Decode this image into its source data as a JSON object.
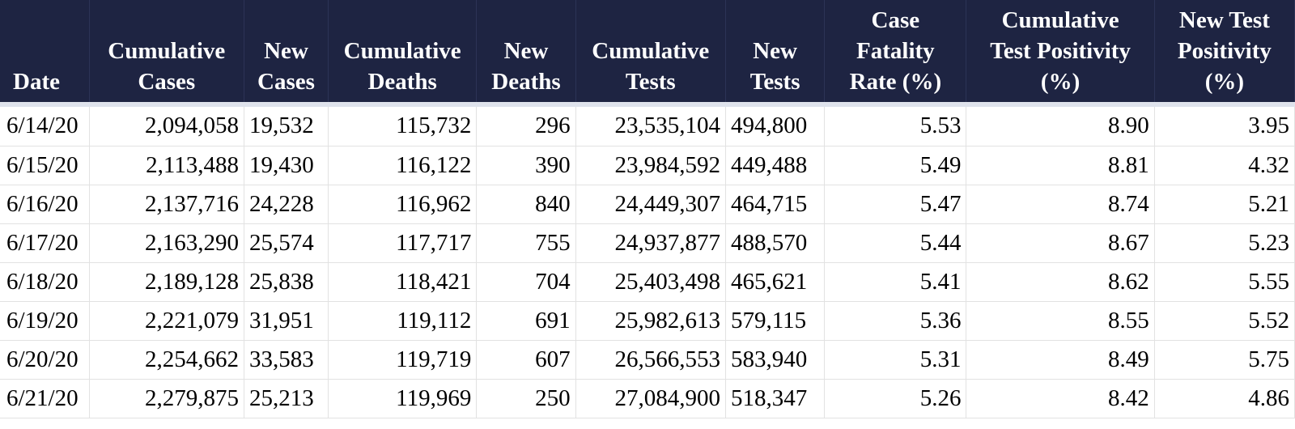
{
  "table": {
    "headers": [
      "Date",
      "Cumulative\nCases",
      "New\nCases",
      "Cumulative\nDeaths",
      "New\nDeaths",
      "Cumulative\nTests",
      "New\nTests",
      "Case\nFatality\nRate (%)",
      "Cumulative\nTest Positivity\n(%)",
      "New Test\nPositivity\n(%)"
    ],
    "rows": [
      [
        "6/14/20",
        "2,094,058",
        "19,532",
        "115,732",
        "296",
        "23,535,104",
        "494,800",
        "5.53",
        "8.90",
        "3.95"
      ],
      [
        "6/15/20",
        "2,113,488",
        "19,430",
        "116,122",
        "390",
        "23,984,592",
        "449,488",
        "5.49",
        "8.81",
        "4.32"
      ],
      [
        "6/16/20",
        "2,137,716",
        "24,228",
        "116,962",
        "840",
        "24,449,307",
        "464,715",
        "5.47",
        "8.74",
        "5.21"
      ],
      [
        "6/17/20",
        "2,163,290",
        "25,574",
        "117,717",
        "755",
        "24,937,877",
        "488,570",
        "5.44",
        "8.67",
        "5.23"
      ],
      [
        "6/18/20",
        "2,189,128",
        "25,838",
        "118,421",
        "704",
        "25,403,498",
        "465,621",
        "5.41",
        "8.62",
        "5.55"
      ],
      [
        "6/19/20",
        "2,221,079",
        "31,951",
        "119,112",
        "691",
        "25,982,613",
        "579,115",
        "5.36",
        "8.55",
        "5.52"
      ],
      [
        "6/20/20",
        "2,254,662",
        "33,583",
        "119,719",
        "607",
        "26,566,553",
        "583,940",
        "5.31",
        "8.49",
        "5.75"
      ],
      [
        "6/21/20",
        "2,279,875",
        "25,213",
        "119,969",
        "250",
        "27,084,900",
        "518,347",
        "5.26",
        "8.42",
        "4.86"
      ]
    ]
  },
  "colors": {
    "header_bg": "#1e2442",
    "header_text": "#ffffff",
    "grid_line": "#e2e2e2"
  }
}
